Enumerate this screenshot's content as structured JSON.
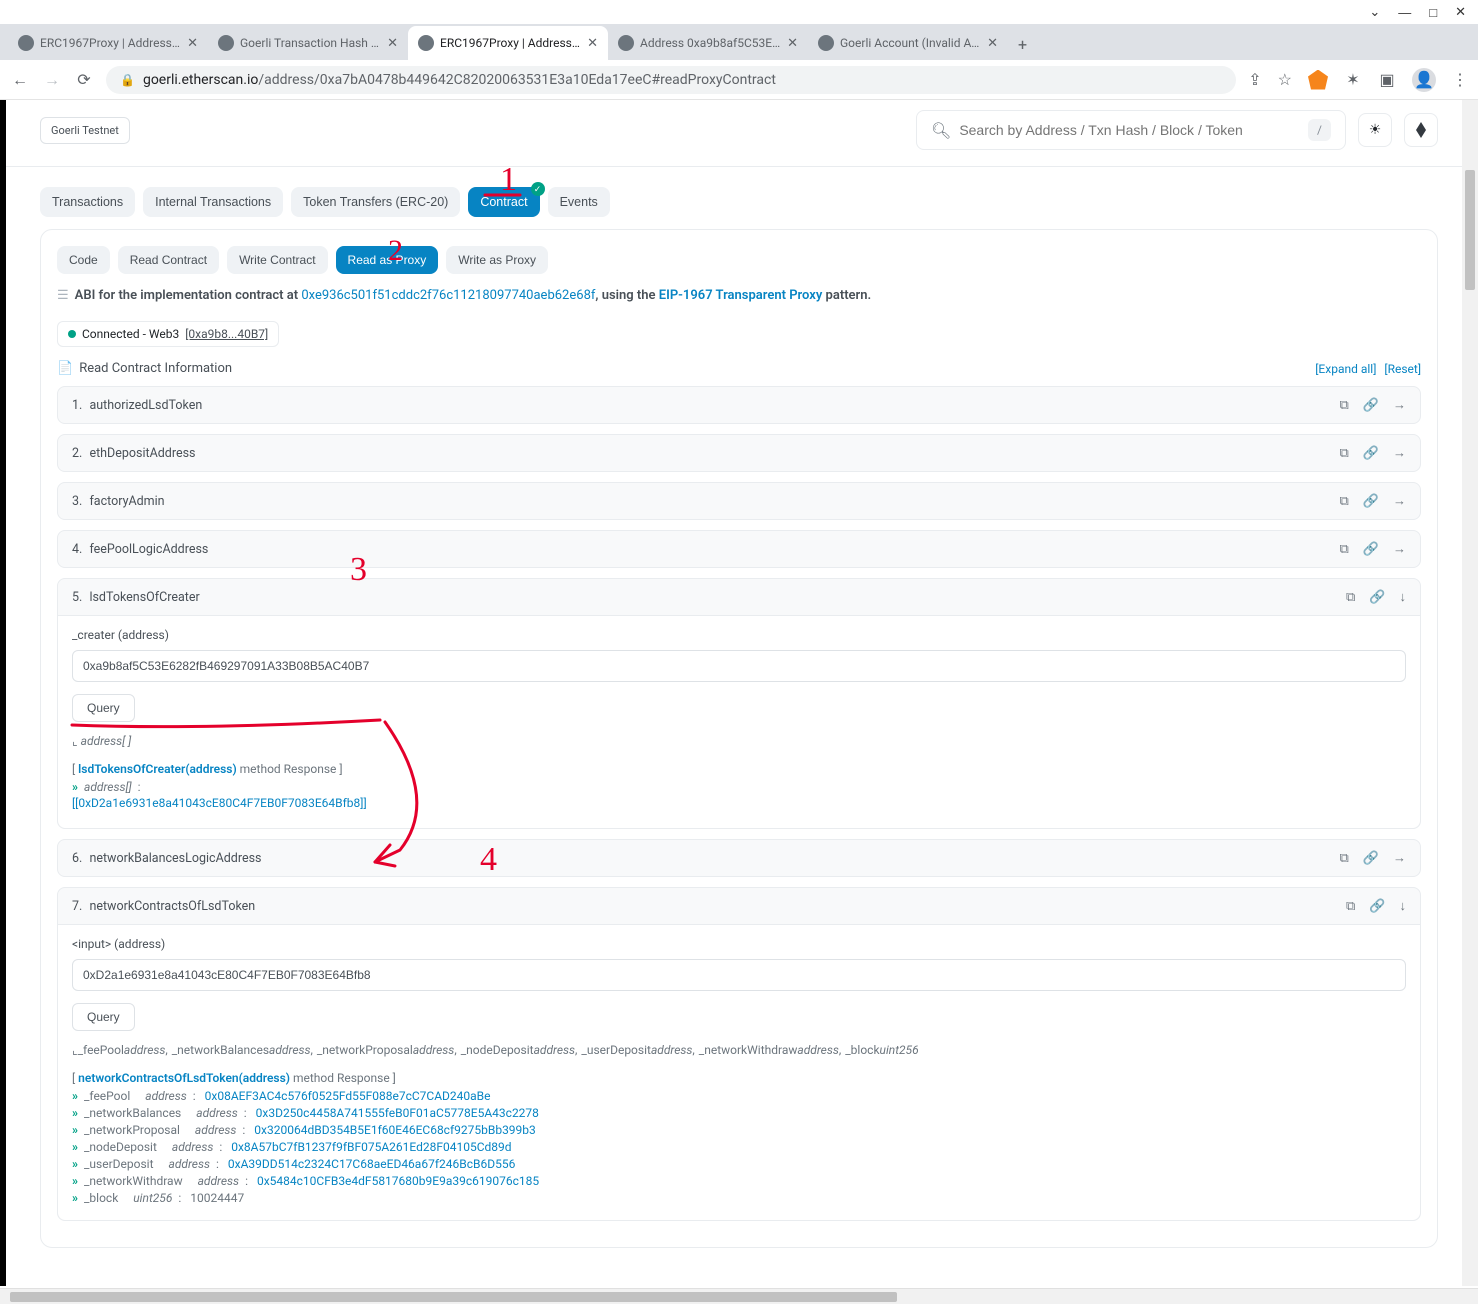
{
  "window": {
    "minimize": "—",
    "maximize": "□",
    "close": "✕",
    "down": "⌄"
  },
  "tabs": [
    {
      "title": "ERC1967Proxy | Address 0x…"
    },
    {
      "title": "Goerli Transaction Hash (Txha…"
    },
    {
      "title": "ERC1967Proxy | Address 0xa7…",
      "active": true
    },
    {
      "title": "Address 0xa9b8af5C53E6282f…"
    },
    {
      "title": "Goerli Account (Invalid Addre…"
    }
  ],
  "addr": {
    "host": "goerli.etherscan.io",
    "path": "/address/0xa7bA0478b449642C82020063531E3a10Eda17eeC#readProxyContract"
  },
  "header": {
    "testnet": "Goerli Testnet",
    "search_placeholder": "Search by Address / Txn Hash / Block / Token",
    "kbd": "/"
  },
  "main_tabs": [
    "Transactions",
    "Internal Transactions",
    "Token Transfers (ERC-20)",
    "Contract",
    "Events"
  ],
  "sub_tabs": [
    "Code",
    "Read Contract",
    "Write Contract",
    "Read as Proxy",
    "Write as Proxy"
  ],
  "abi": {
    "pre": "ABI for the implementation contract at ",
    "impl": "0xe936c501f51cddc2f76c11218097740aeb62e68f",
    "mid": ", using the ",
    "proxy": "EIP-1967 Transparent Proxy",
    "post": " pattern."
  },
  "connected": {
    "label": "Connected - Web3 ",
    "addr": "[0xa9b8...40B7]"
  },
  "section": {
    "title": "Read Contract Information",
    "expand": "[Expand all]",
    "reset": "[Reset]"
  },
  "funcs": [
    {
      "n": "1.",
      "name": "authorizedLsdToken"
    },
    {
      "n": "2.",
      "name": "ethDepositAddress"
    },
    {
      "n": "3.",
      "name": "factoryAdmin"
    },
    {
      "n": "4.",
      "name": "feePoolLogicAddress"
    },
    {
      "n": "5.",
      "name": "lsdTokensOfCreater"
    },
    {
      "n": "6.",
      "name": "networkBalancesLogicAddress"
    },
    {
      "n": "7.",
      "name": "networkContractsOfLsdToken"
    }
  ],
  "f5": {
    "param_label": "_creater (address)",
    "input_value": "0xa9b8af5C53E6282fB469297091A33B08B5AC40B7",
    "query": "Query",
    "ret_type": "address[ ]",
    "resp_header_name": "lsdTokensOfCreater(address)",
    "resp_header_tail": " method Response ]",
    "resp_type": "address[]",
    "resp_value": "[[0xD2a1e6931e8a41043cE80C4F7EB0F7083E64Bfb8]]"
  },
  "f7": {
    "param_label": "<input> (address)",
    "input_value": "0xD2a1e6931e8a41043cE80C4F7EB0F7083E64Bfb8",
    "query": "Query",
    "schema": [
      {
        "name": "_feePool",
        "type": "address"
      },
      {
        "name": "_networkBalances",
        "type": "address"
      },
      {
        "name": "_networkProposal",
        "type": "address"
      },
      {
        "name": "_nodeDeposit",
        "type": "address"
      },
      {
        "name": "_userDeposit",
        "type": "address"
      },
      {
        "name": "_networkWithdraw",
        "type": "address"
      },
      {
        "name": "_block",
        "type": "uint256"
      }
    ],
    "resp_header_name": "networkContractsOfLsdToken(address)",
    "resp_header_tail": " method Response ]",
    "results": [
      {
        "name": "_feePool",
        "type": "address",
        "value": "0x08AEF3AC4c576f0525Fd55F088e7cC7CAD240aBe"
      },
      {
        "name": "_networkBalances",
        "type": "address",
        "value": "0x3D250c4458A741555feB0F01aC5778E5A43c2278"
      },
      {
        "name": "_networkProposal",
        "type": "address",
        "value": "0x320064dBD354B5E1f60E46EC68cf9275bBb399b3"
      },
      {
        "name": "_nodeDeposit",
        "type": "address",
        "value": "0x8A57bC7fB1237f9fBF075A261Ed28F04105Cd89d"
      },
      {
        "name": "_userDeposit",
        "type": "address",
        "value": "0xA39DD514c2324C17C68aeED46a67f246BcB6D556"
      },
      {
        "name": "_networkWithdraw",
        "type": "address",
        "value": "0x5484c10CFB3e4dF5817680b9E9a39c619076c185"
      },
      {
        "name": "_block",
        "type": "uint256",
        "value": "10024447",
        "is_num": true
      }
    ]
  },
  "ann": {
    "1": "1",
    "2": "2",
    "3": "3",
    "4": "4"
  },
  "icons": {
    "copy": "⧉",
    "link": "🔗",
    "arrow_r": "→",
    "arrow_d": "↓",
    "file": "📄",
    "layers": "☰",
    "sun": "☀",
    "search": "🔍︎",
    "star": "☆",
    "share": "⇪"
  }
}
